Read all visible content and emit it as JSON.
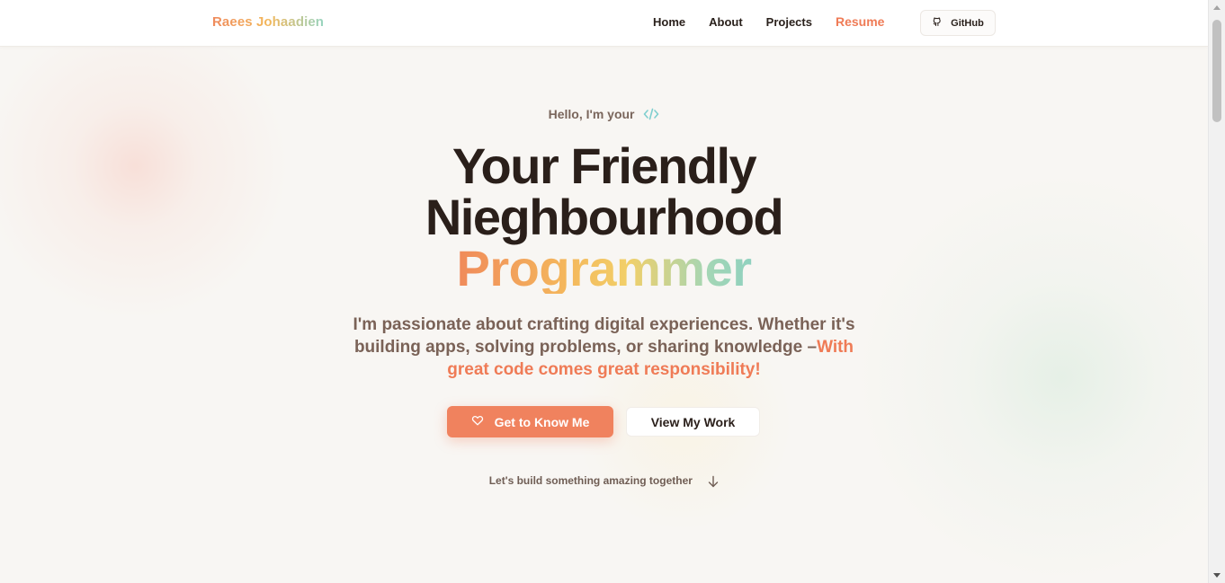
{
  "nav": {
    "brand": "Raees Johaadien",
    "links": [
      {
        "label": "Home"
      },
      {
        "label": "About"
      },
      {
        "label": "Projects"
      },
      {
        "label": "Resume"
      }
    ],
    "github_label": "GitHub"
  },
  "hero": {
    "greeting": "Hello, I'm your",
    "headline_line1": "Your Friendly",
    "headline_line2": "Nieghbourhood",
    "headline_highlight": "Programmer",
    "tagline_part1": "I'm passionate about crafting digital experiences. Whether it's building apps, solving problems, or sharing knowledge –",
    "tagline_highlight": "With great code comes great responsibility!",
    "primary_button": "Get to Know Me",
    "secondary_button": "View My Work",
    "scroll_hint": "Let's build something amazing together"
  },
  "icons": {
    "greeting_icon": "code-icon",
    "github_icon": "github-icon",
    "primary_button_icon": "heart-icon",
    "scroll_icon": "arrow-down-icon"
  },
  "colors": {
    "accent": "#f0825e",
    "background": "#f8f6f3",
    "text_dark": "#2a1f1a",
    "text_muted": "#7a6257"
  }
}
